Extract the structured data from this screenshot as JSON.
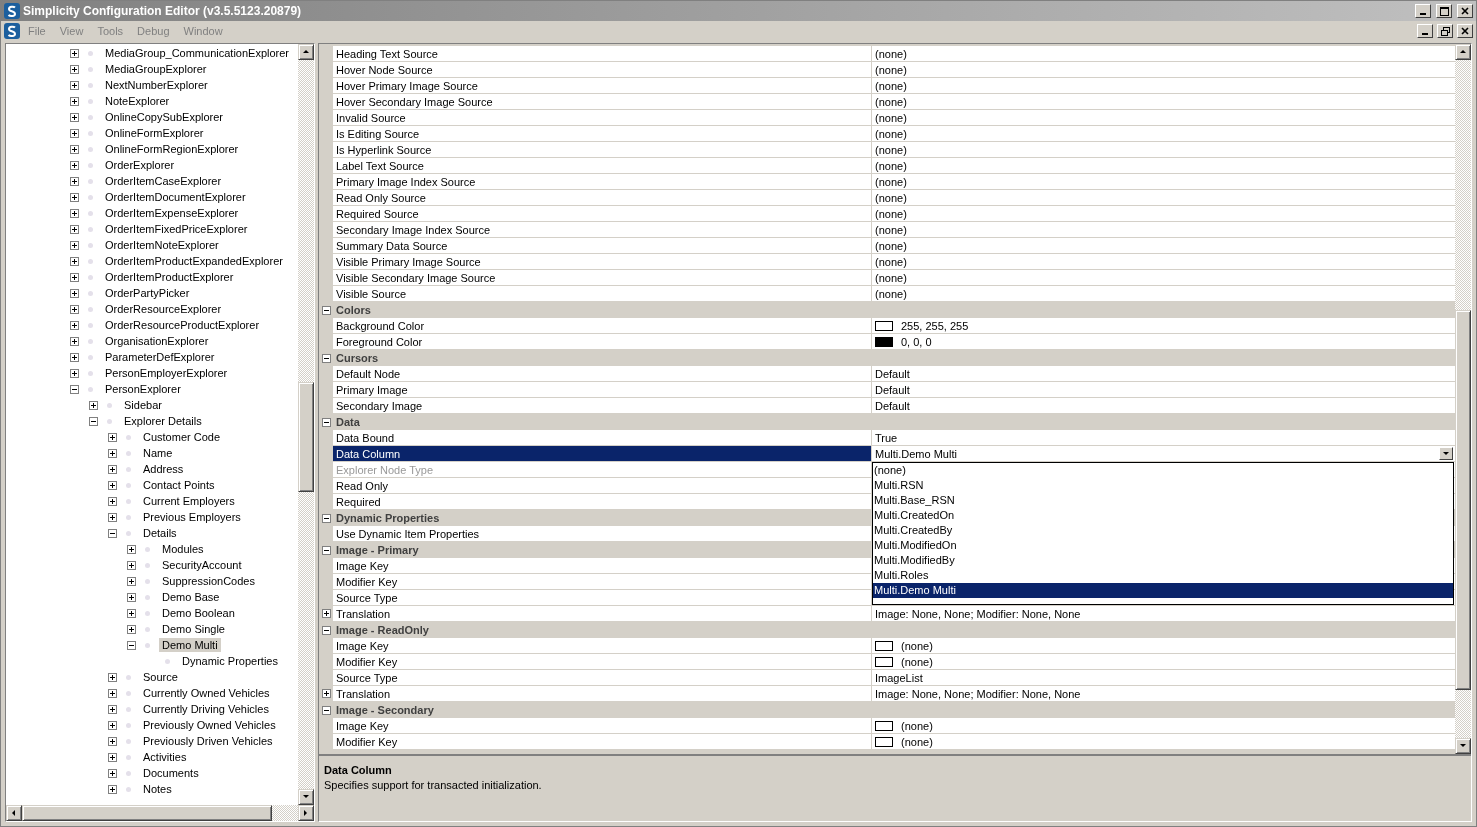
{
  "window": {
    "title": "Simplicity Configuration Editor (v3.5.5123.20879)"
  },
  "menu": [
    {
      "label": "File",
      "disabled": true
    },
    {
      "label": "View",
      "disabled": true
    },
    {
      "label": "Tools",
      "disabled": true
    },
    {
      "label": "Debug",
      "disabled": true
    },
    {
      "label": "Window",
      "disabled": true
    }
  ],
  "tree": {
    "items": [
      {
        "label": "MediaGroup_CommunicationExplorer",
        "expanded": false,
        "selected": false
      },
      {
        "label": "MediaGroupExplorer",
        "expanded": false,
        "selected": false
      },
      {
        "label": "NextNumberExplorer",
        "expanded": false,
        "selected": false
      },
      {
        "label": "NoteExplorer",
        "expanded": false,
        "selected": false
      },
      {
        "label": "OnlineCopySubExplorer",
        "expanded": false,
        "selected": false
      },
      {
        "label": "OnlineFormExplorer",
        "expanded": false,
        "selected": false
      },
      {
        "label": "OnlineFormRegionExplorer",
        "expanded": false,
        "selected": false
      },
      {
        "label": "OrderExplorer",
        "expanded": false,
        "selected": false
      },
      {
        "label": "OrderItemCaseExplorer",
        "expanded": false,
        "selected": false
      },
      {
        "label": "OrderItemDocumentExplorer",
        "expanded": false,
        "selected": false
      },
      {
        "label": "OrderItemExpenseExplorer",
        "expanded": false,
        "selected": false
      },
      {
        "label": "OrderItemFixedPriceExplorer",
        "expanded": false,
        "selected": false
      },
      {
        "label": "OrderItemNoteExplorer",
        "expanded": false,
        "selected": false
      },
      {
        "label": "OrderItemProductExpandedExplorer",
        "expanded": false,
        "selected": false
      },
      {
        "label": "OrderItemProductExplorer",
        "expanded": false,
        "selected": false
      },
      {
        "label": "OrderPartyPicker",
        "expanded": false,
        "selected": false
      },
      {
        "label": "OrderResourceExplorer",
        "expanded": false,
        "selected": false
      },
      {
        "label": "OrderResourceProductExplorer",
        "expanded": false,
        "selected": false
      },
      {
        "label": "OrganisationExplorer",
        "expanded": false,
        "selected": false
      },
      {
        "label": "ParameterDefExplorer",
        "expanded": false,
        "selected": false
      },
      {
        "label": "PersonEmployerExplorer",
        "expanded": false,
        "selected": false
      },
      {
        "label": "PersonExplorer",
        "expanded": true,
        "selected": false,
        "children": [
          {
            "label": "Sidebar",
            "expanded": false,
            "selected": false
          },
          {
            "label": "Explorer Details",
            "expanded": true,
            "selected": false,
            "children": [
              {
                "label": "Customer Code",
                "expanded": false,
                "selected": false
              },
              {
                "label": "Name",
                "expanded": false,
                "selected": false
              },
              {
                "label": "Address",
                "expanded": false,
                "selected": false
              },
              {
                "label": "Contact Points",
                "expanded": false,
                "selected": false
              },
              {
                "label": "Current Employers",
                "expanded": false,
                "selected": false
              },
              {
                "label": "Previous Employers",
                "expanded": false,
                "selected": false
              },
              {
                "label": "Details",
                "expanded": true,
                "selected": false,
                "children": [
                  {
                    "label": "Modules",
                    "expanded": false,
                    "selected": false
                  },
                  {
                    "label": "SecurityAccount",
                    "expanded": false,
                    "selected": false
                  },
                  {
                    "label": "SuppressionCodes",
                    "expanded": false,
                    "selected": false
                  },
                  {
                    "label": "Demo Base",
                    "expanded": false,
                    "selected": false
                  },
                  {
                    "label": "Demo Boolean",
                    "expanded": false,
                    "selected": false
                  },
                  {
                    "label": "Demo Single",
                    "expanded": false,
                    "selected": false
                  },
                  {
                    "label": "Demo Multi",
                    "expanded": true,
                    "selected": true,
                    "children": [
                      {
                        "label": "Dynamic Properties",
                        "selected": false
                      }
                    ]
                  }
                ]
              },
              {
                "label": "Source",
                "expanded": false,
                "selected": false
              },
              {
                "label": "Currently Owned Vehicles",
                "expanded": false,
                "selected": false
              },
              {
                "label": "Currently Driving Vehicles",
                "expanded": false,
                "selected": false
              },
              {
                "label": "Previously Owned Vehicles",
                "expanded": false,
                "selected": false
              },
              {
                "label": "Previously Driven Vehicles",
                "expanded": false,
                "selected": false
              },
              {
                "label": "Activities",
                "expanded": false,
                "selected": false
              },
              {
                "label": "Documents",
                "expanded": false,
                "selected": false
              },
              {
                "label": "Notes",
                "expanded": false,
                "selected": false
              }
            ]
          }
        ]
      }
    ]
  },
  "property_grid": {
    "rows": [
      {
        "kind": "text",
        "label": "Heading Text Source",
        "value": "(none)",
        "selected": false,
        "disabled": false
      },
      {
        "kind": "text",
        "label": "Hover Node Source",
        "value": "(none)",
        "selected": false,
        "disabled": false
      },
      {
        "kind": "text",
        "label": "Hover Primary Image Source",
        "value": "(none)",
        "selected": false,
        "disabled": false
      },
      {
        "kind": "text",
        "label": "Hover Secondary Image Source",
        "value": "(none)",
        "selected": false,
        "disabled": false
      },
      {
        "kind": "text",
        "label": "Invalid Source",
        "value": "(none)",
        "selected": false,
        "disabled": false
      },
      {
        "kind": "text",
        "label": "Is Editing Source",
        "value": "(none)",
        "selected": false,
        "disabled": false
      },
      {
        "kind": "text",
        "label": "Is Hyperlink Source",
        "value": "(none)",
        "selected": false,
        "disabled": false
      },
      {
        "kind": "text",
        "label": "Label Text Source",
        "value": "(none)",
        "selected": false,
        "disabled": false
      },
      {
        "kind": "text",
        "label": "Primary Image Index Source",
        "value": "(none)",
        "selected": false,
        "disabled": false
      },
      {
        "kind": "text",
        "label": "Read Only Source",
        "value": "(none)",
        "selected": false,
        "disabled": false
      },
      {
        "kind": "text",
        "label": "Required Source",
        "value": "(none)",
        "selected": false,
        "disabled": false
      },
      {
        "kind": "text",
        "label": "Secondary Image Index Source",
        "value": "(none)",
        "selected": false,
        "disabled": false
      },
      {
        "kind": "text",
        "label": "Summary Data Source",
        "value": "(none)",
        "selected": false,
        "disabled": false
      },
      {
        "kind": "text",
        "label": "Visible Primary Image Source",
        "value": "(none)",
        "selected": false,
        "disabled": false
      },
      {
        "kind": "text",
        "label": "Visible Secondary Image Source",
        "value": "(none)",
        "selected": false,
        "disabled": false
      },
      {
        "kind": "text",
        "label": "Visible Source",
        "value": "(none)",
        "selected": false,
        "disabled": false
      },
      {
        "kind": "category",
        "label": "Colors",
        "expanded": true
      },
      {
        "kind": "swatch",
        "label": "Background Color",
        "value": "255, 255, 255",
        "color": "#ffffff",
        "selected": false,
        "disabled": false
      },
      {
        "kind": "swatch",
        "label": "Foreground Color",
        "value": "0, 0, 0",
        "color": "#000000",
        "selected": false,
        "disabled": false
      },
      {
        "kind": "category",
        "label": "Cursors",
        "expanded": true
      },
      {
        "kind": "text",
        "label": "Default Node",
        "value": "Default",
        "selected": false,
        "disabled": false
      },
      {
        "kind": "text",
        "label": "Primary Image",
        "value": "Default",
        "selected": false,
        "disabled": false
      },
      {
        "kind": "text",
        "label": "Secondary Image",
        "value": "Default",
        "selected": false,
        "disabled": false
      },
      {
        "kind": "category",
        "label": "Data",
        "expanded": true
      },
      {
        "kind": "text",
        "label": "Data Bound",
        "value": "True",
        "selected": false,
        "disabled": false
      },
      {
        "kind": "dropdown",
        "label": "Data Column",
        "value": "Multi.Demo Multi",
        "selected": true,
        "disabled": false,
        "options": [
          {
            "label": "(none)",
            "selected": false
          },
          {
            "label": "Multi.RSN",
            "selected": false
          },
          {
            "label": "Multi.Base_RSN",
            "selected": false
          },
          {
            "label": "Multi.CreatedOn",
            "selected": false
          },
          {
            "label": "Multi.CreatedBy",
            "selected": false
          },
          {
            "label": "Multi.ModifiedOn",
            "selected": false
          },
          {
            "label": "Multi.ModifiedBy",
            "selected": false
          },
          {
            "label": "Multi.Roles",
            "selected": false
          },
          {
            "label": "Multi.Demo Multi",
            "selected": true
          }
        ]
      },
      {
        "kind": "text",
        "label": "Explorer Node Type",
        "selected": false,
        "disabled": true
      },
      {
        "kind": "text",
        "label": "Read Only",
        "selected": false,
        "disabled": false
      },
      {
        "kind": "text",
        "label": "Required",
        "selected": false,
        "disabled": false
      },
      {
        "kind": "category",
        "label": "Dynamic Properties",
        "expanded": true
      },
      {
        "kind": "text",
        "label": "Use Dynamic Item Properties",
        "selected": false,
        "disabled": false
      },
      {
        "kind": "category",
        "label": "Image - Primary",
        "expanded": true
      },
      {
        "kind": "text",
        "label": "Image Key",
        "selected": false,
        "disabled": false
      },
      {
        "kind": "text",
        "label": "Modifier Key",
        "selected": false,
        "disabled": false
      },
      {
        "kind": "text",
        "label": "Source Type",
        "selected": false,
        "disabled": false
      },
      {
        "kind": "text",
        "label": "Translation",
        "value": "Image: None, None; Modifier: None, None",
        "expanded": false,
        "selected": false,
        "disabled": false
      },
      {
        "kind": "category",
        "label": "Image - ReadOnly",
        "expanded": true
      },
      {
        "kind": "swatch",
        "label": "Image Key",
        "value": "(none)",
        "color": "#ffffff",
        "selected": false,
        "disabled": false
      },
      {
        "kind": "swatch",
        "label": "Modifier Key",
        "value": "(none)",
        "color": "#ffffff",
        "selected": false,
        "disabled": false
      },
      {
        "kind": "text",
        "label": "Source Type",
        "value": "ImageList",
        "selected": false,
        "disabled": false
      },
      {
        "kind": "text",
        "label": "Translation",
        "value": "Image: None, None; Modifier: None, None",
        "expanded": false,
        "selected": false,
        "disabled": false
      },
      {
        "kind": "category",
        "label": "Image - Secondary",
        "expanded": true
      },
      {
        "kind": "swatch",
        "label": "Image Key",
        "value": "(none)",
        "color": "#ffffff",
        "selected": false,
        "disabled": false
      },
      {
        "kind": "swatch",
        "label": "Modifier Key",
        "value": "(none)",
        "color": "#ffffff",
        "selected": false,
        "disabled": false
      }
    ]
  },
  "description": {
    "title": "Data Column",
    "text": "Specifies support for transacted initialization."
  }
}
